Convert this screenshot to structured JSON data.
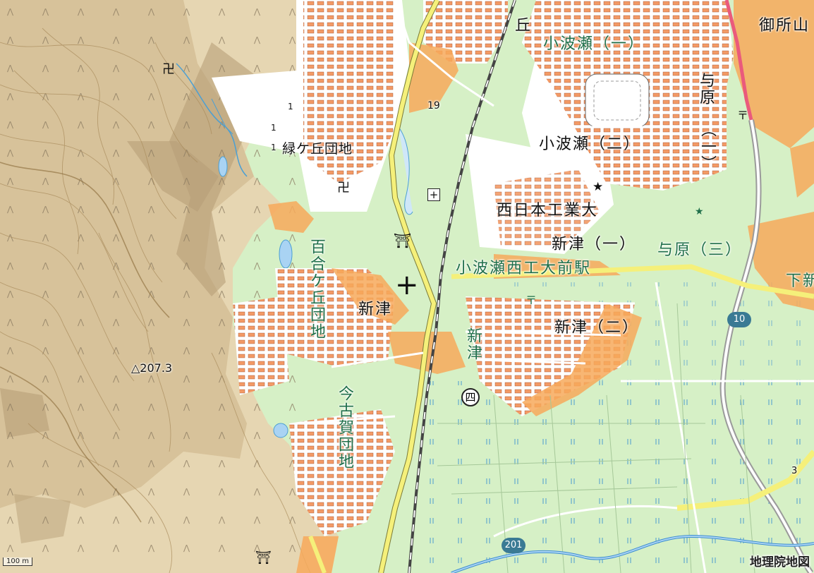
{
  "map": {
    "labels": {
      "midorigaoka_oka": "丘",
      "kobase_1": "小波瀬（一）",
      "kobase_2": "小波瀬（二）",
      "yobaru": "与原",
      "yobaru_1": "（一）",
      "gosho": "御所山",
      "midorigaoka_danchi": "緑ケ丘団地",
      "nishinippon_u": "西日本工業大",
      "shintsu_1": "新津（一）",
      "yobaru_3": "与原（三）",
      "station": "小波瀬西工大前駅",
      "shimo": "下新",
      "yurigaoka": "百合ケ丘団地",
      "shintsu": "新津",
      "shintsu_2": "新津（二）",
      "shintsu_4_name": "新津",
      "shintsu_4_num": "四",
      "imagoga": "今古賀団地",
      "summit": "△207.3",
      "contour_1a": "1",
      "contour_1b": "1",
      "contour_1c": "1",
      "road_19": "19",
      "point_3": "3"
    },
    "route_shields": {
      "r10": "10",
      "r201": "201"
    },
    "scale": "100 m",
    "credit": "地理院地図",
    "icons": [
      "temple-icon",
      "temple-icon",
      "shrine-icon",
      "shrine-icon",
      "hospital-icon",
      "university-icon",
      "post-office-icon",
      "post-office-icon",
      "elementary-school-icon"
    ]
  }
}
